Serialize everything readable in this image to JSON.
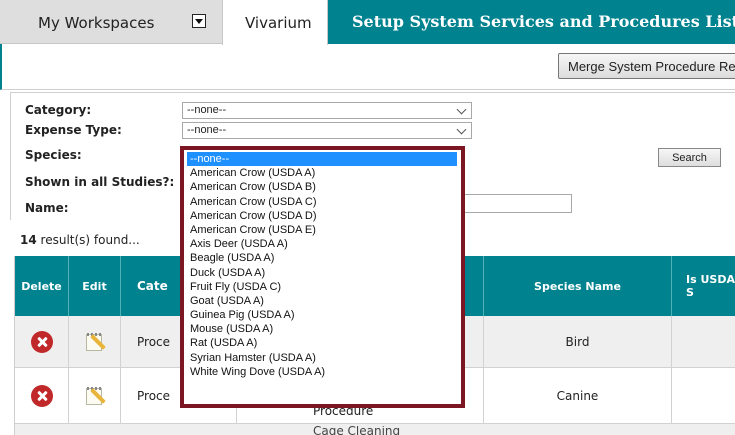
{
  "tabs": {
    "workspaces": "My Workspaces",
    "vivarium": "Vivarium",
    "setup": "Setup System Services and Procedures List"
  },
  "toolbar": {
    "merge_button": "Merge System Procedure Re"
  },
  "filters": {
    "category_label": "Category:",
    "category_value": "--none--",
    "expense_type_label": "Expense Type:",
    "expense_type_value": "--none--",
    "species_label": "Species:",
    "shown_label": "Shown in all Studies?:",
    "name_label": "Name:",
    "search_button": "Search"
  },
  "results": {
    "count": "14",
    "suffix": "result(s) found..."
  },
  "table": {
    "headers": {
      "delete": "Delete",
      "edit": "Edit",
      "category": "Cate",
      "species_name": "Species Name",
      "usda": "Is USDA S"
    },
    "rows": [
      {
        "category": "Proce",
        "species": "Bird"
      },
      {
        "category": "Proce",
        "species": "Canine",
        "name_cont": "Procedure"
      }
    ],
    "row3_partial": "Cage Cleaning"
  },
  "species_dropdown": {
    "selected": "--none--",
    "options": [
      "--none--",
      "American Crow (USDA A)",
      "American Crow (USDA B)",
      "American Crow (USDA C)",
      "American Crow (USDA D)",
      "American Crow (USDA E)",
      "Axis Deer (USDA A)",
      "Beagle (USDA A)",
      "Duck (USDA A)",
      "Fruit Fly (USDA C)",
      "Goat (USDA A)",
      "Guinea Pig (USDA A)",
      "Mouse (USDA A)",
      "Rat (USDA A)",
      "Syrian Hamster (USDA A)",
      "White Wing Dove (USDA A)"
    ]
  },
  "colors": {
    "teal": "#00838f",
    "highlight": "#1e90ff",
    "dropdown_border": "#7b1622",
    "delete_red": "#c0282a"
  }
}
